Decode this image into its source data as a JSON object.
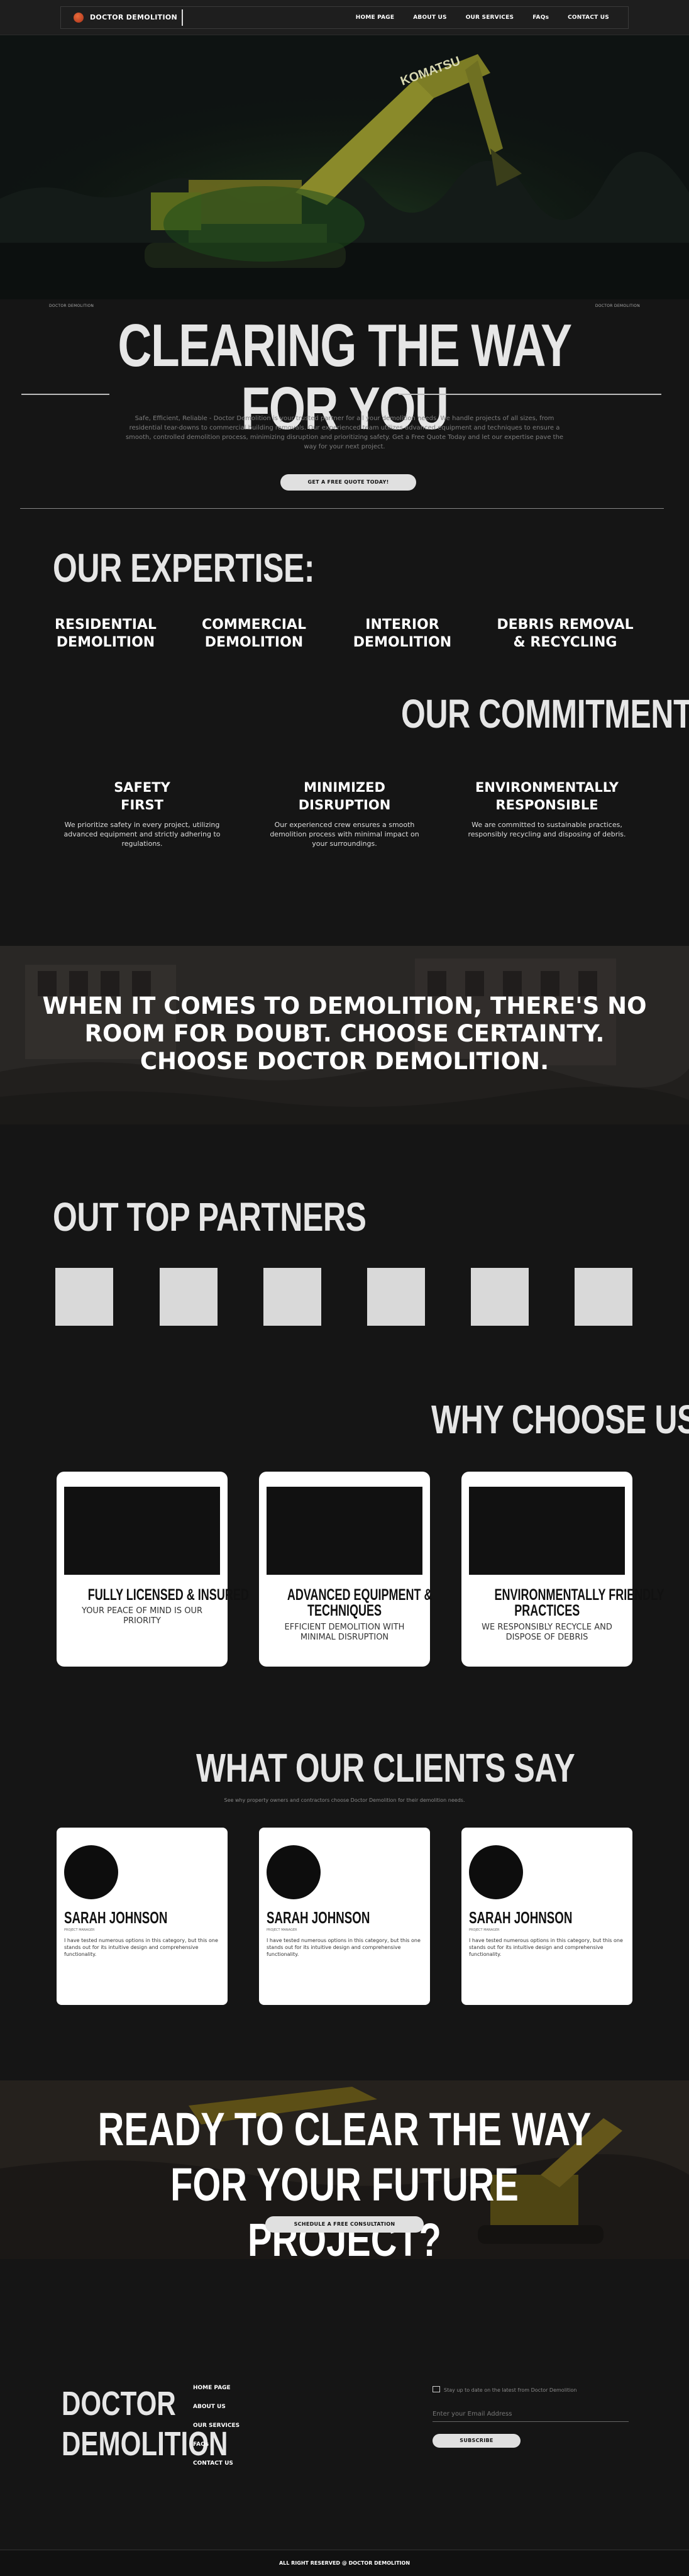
{
  "nav": {
    "brand": "DOCTOR DEMOLITION",
    "links": [
      "HOME PAGE",
      "ABOUT US",
      "OUR SERVICES",
      "FAQs",
      "CONTACT US"
    ]
  },
  "hero": {
    "label_left": "DOCTOR DEMOLITION",
    "label_right": "DOCTOR DEMOLITION",
    "title": "CLEARING THE WAY FOR YOU",
    "paragraph": "Safe, Efficient, Reliable - Doctor Demolition is your trusted partner for all your demolition needs. We handle projects of all sizes, from residential tear-downs to commercial building removals. Our experienced team utilizes advanced equipment and techniques to ensure a smooth, controlled demolition process, minimizing disruption and prioritizing safety. Get a Free Quote Today and let our expertise pave the way for your next project.",
    "cta_label": "GET A FREE QUOTE TODAY!"
  },
  "expertise": {
    "heading": "OUR EXPERTISE:",
    "items": [
      {
        "line1": "RESIDENTIAL",
        "line2": "DEMOLITION"
      },
      {
        "line1": "COMMERCIAL",
        "line2": "DEMOLITION"
      },
      {
        "line1": "INTERIOR",
        "line2": "DEMOLITION"
      },
      {
        "line1": "DEBRIS REMOVAL",
        "line2": "& RECYCLING"
      }
    ]
  },
  "commitment": {
    "heading": "OUR COMMITMENT",
    "items": [
      {
        "line1": "SAFETY",
        "line2": "FIRST",
        "desc": "We prioritize safety in every project, utilizing advanced equipment and strictly adhering to regulations."
      },
      {
        "line1": "MINIMIZED",
        "line2": "DISRUPTION",
        "desc": "Our experienced crew ensures a smooth demolition process with minimal impact on your surroundings."
      },
      {
        "line1": "ENVIRONMENTALLY",
        "line2": "RESPONSIBLE",
        "desc": "We are committed to sustainable practices, responsibly recycling and disposing of debris."
      }
    ]
  },
  "banner": {
    "text": "WHEN IT COMES TO DEMOLITION, THERE'S NO ROOM FOR DOUBT. CHOOSE CERTAINTY. CHOOSE DOCTOR DEMOLITION."
  },
  "partners": {
    "heading": "OUT TOP PARTNERS",
    "count": 6
  },
  "why": {
    "heading": "WHY CHOOSE US",
    "cards": [
      {
        "title_1": "FULLY LICENSED & INSURED",
        "title_2": "",
        "desc": "YOUR PEACE OF MIND IS OUR PRIORITY"
      },
      {
        "title_1": "ADVANCED EQUIPMENT &",
        "title_2": "TECHNIQUES",
        "desc": "EFFICIENT DEMOLITION WITH MINIMAL DISRUPTION"
      },
      {
        "title_1": "ENVIRONMENTALLY FRIENDLY",
        "title_2": "PRACTICES",
        "desc": "WE RESPONSIBLY RECYCLE AND DISPOSE OF DEBRIS"
      }
    ]
  },
  "testimonials": {
    "heading": "WHAT OUR CLIENTS SAY",
    "subheading": "See why property owners and contractors choose Doctor Demolition for their demolition needs.",
    "cards": [
      {
        "name": "SARAH JOHNSON",
        "role": "PROJECT MANAGER",
        "quote": "I have tested numerous options in this category, but this one stands out for its intuitive design and comprehensive functionality."
      },
      {
        "name": "SARAH JOHNSON",
        "role": "PROJECT MANAGER",
        "quote": "I have tested numerous options in this category, but this one stands out for its intuitive design and comprehensive functionality."
      },
      {
        "name": "SARAH JOHNSON",
        "role": "PROJECT MANAGER",
        "quote": "I have tested numerous options in this category, but this one stands out for its intuitive design and comprehensive functionality."
      }
    ]
  },
  "cta": {
    "line1": "READY TO CLEAR THE WAY FOR YOUR FUTURE",
    "line2": "PROJECT?",
    "button": "SCHEDULE A FREE CONSULTATION"
  },
  "footer": {
    "logo_line1": "DOCTOR",
    "logo_line2": "DEMOLITION",
    "links": [
      "HOME PAGE",
      "ABOUT US",
      "OUR SERVICES",
      "FAQs",
      "CONTACT US"
    ],
    "subscribe_text": "Stay up to date on the latest from Doctor Demolition",
    "email_placeholder": "Enter your Email Address",
    "subscribe_button": "SUBSCRIBE",
    "copyright": "ALL RIGHT RESERVED @ DOCTOR DEMOLITION"
  },
  "colors": {
    "background": "#151515",
    "accent_logo": "#c8452a",
    "card": "#ffffff",
    "button": "#e0e0e0"
  }
}
